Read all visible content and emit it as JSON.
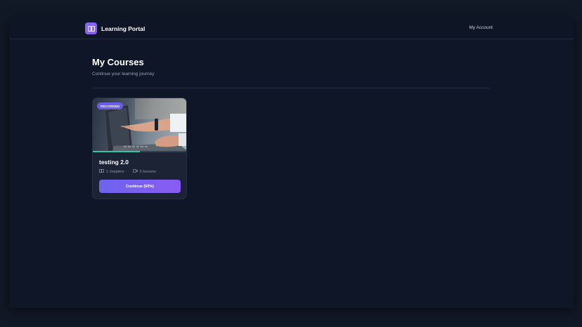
{
  "header": {
    "brand_name": "Learning Portal",
    "brand_icon": "book-icon",
    "account_label": "My Account"
  },
  "main": {
    "title": "My Courses",
    "subtitle": "Continue your learning journey"
  },
  "courses": [
    {
      "badge": "RECORDED",
      "title": "testing 2.0",
      "chapters": "1 chapters",
      "lessons": "2 lessons",
      "button_label": "Continue (50%)",
      "progress": 0.5
    }
  ],
  "colors": {
    "accent": "#6c5ce7",
    "progress": "#2ec4a6",
    "background": "#0f1627"
  }
}
